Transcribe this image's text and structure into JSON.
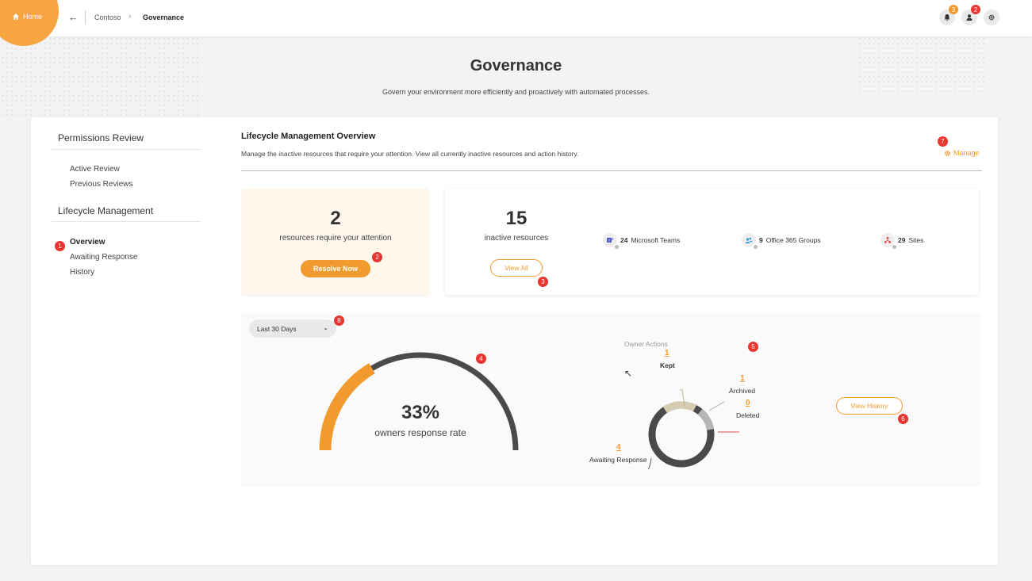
{
  "topbar": {
    "home_label": "Home",
    "breadcrumb": [
      "Contoso",
      "Governance"
    ],
    "notification_count": "3",
    "user_count": "2"
  },
  "header": {
    "title": "Governance",
    "subtitle": "Govern your environment more efficiently and proactively with automated processes."
  },
  "sidebar": {
    "permissions_heading": "Permissions Review",
    "permissions_items": [
      "Active Review",
      "Previous Reviews"
    ],
    "lifecycle_heading": "Lifecycle Management",
    "lifecycle_items": [
      "Overview",
      "Awaiting Response",
      "History"
    ]
  },
  "overview": {
    "title": "Lifecycle Management Overview",
    "description": "Manage the inactive resources that require your attention. View all currently inactive resources and action history.",
    "manage_label": "Manage"
  },
  "attention_card": {
    "count": "2",
    "text": "resources require your attention",
    "button": "Resolve Now"
  },
  "inactive_card": {
    "count": "15",
    "text": "inactive resources",
    "button": "View All",
    "resources": [
      {
        "count": "24",
        "label": "Microsoft Teams"
      },
      {
        "count": "9",
        "label": "Office 365 Groups"
      },
      {
        "count": "29",
        "label": "Sites"
      }
    ]
  },
  "stats": {
    "period": "Last 30 Days",
    "response_rate": "33%",
    "response_rate_value": 0.33,
    "response_label": "owners response rate",
    "owner_actions_title": "Owner Actions",
    "actions": [
      {
        "count": "1",
        "label": "Kept"
      },
      {
        "count": "1",
        "label": "Archived"
      },
      {
        "count": "0",
        "label": "Deleted"
      },
      {
        "count": "4",
        "label": "Awaiting Response"
      }
    ],
    "history_button": "View History"
  },
  "badges": [
    "1",
    "2",
    "3",
    "4",
    "5",
    "6",
    "7",
    "8"
  ],
  "colors": {
    "accent": "#f19a2d",
    "badge_red": "#e8352f",
    "dark_arc": "#4a4a4a",
    "kept": "#d6cdb0",
    "archived": "#b5b5b5",
    "deleted": "#d9534f"
  }
}
